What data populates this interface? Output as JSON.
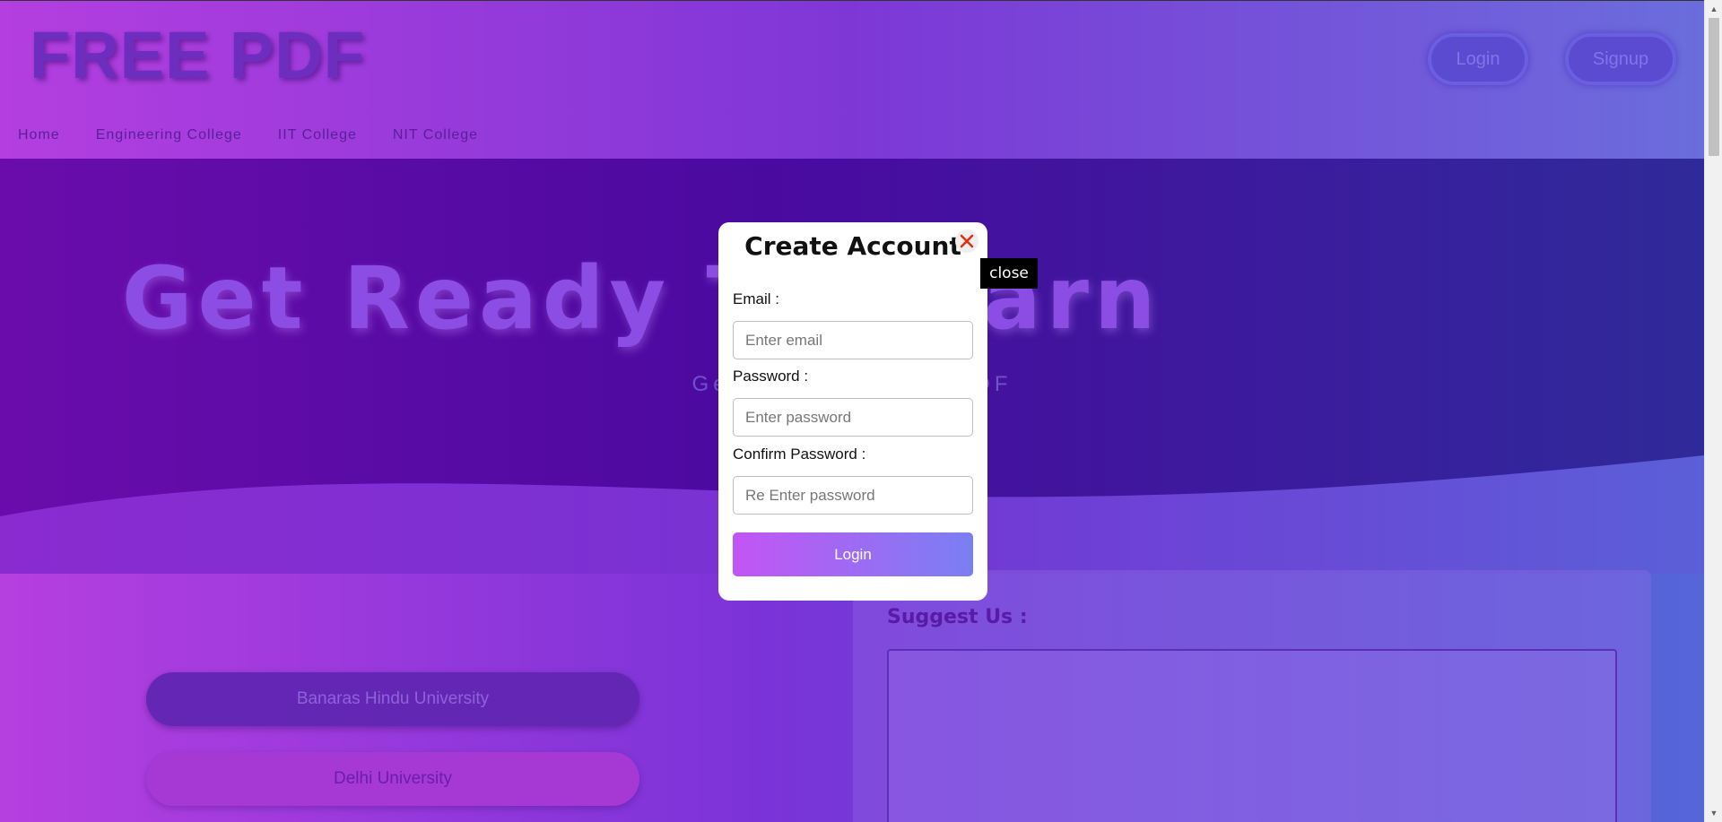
{
  "header": {
    "logo": "FREE PDF",
    "login_label": "Login",
    "signup_label": "Signup",
    "nav": [
      "Home",
      "Engineering College",
      "IIT College",
      "NIT College"
    ]
  },
  "hero": {
    "title": "Get Ready To Learn",
    "subtitle": "Get Here All Exam PDF"
  },
  "universities": [
    "Banaras Hindu University",
    "Delhi University"
  ],
  "suggest": {
    "label": "Suggest Us :"
  },
  "modal": {
    "title": "Create Account",
    "close_tooltip": "close",
    "email_label": "Email :",
    "email_placeholder": "Enter email",
    "password_label": "Password :",
    "password_placeholder": "Enter password",
    "confirm_label": "Confirm Password :",
    "confirm_placeholder": "Re Enter password",
    "submit_label": "Login"
  },
  "colors": {
    "gradient_start": "#c355f5",
    "gradient_end": "#7a7ff2",
    "close_icon": "#e0300f"
  },
  "icons": {
    "close": "close-x-icon"
  }
}
